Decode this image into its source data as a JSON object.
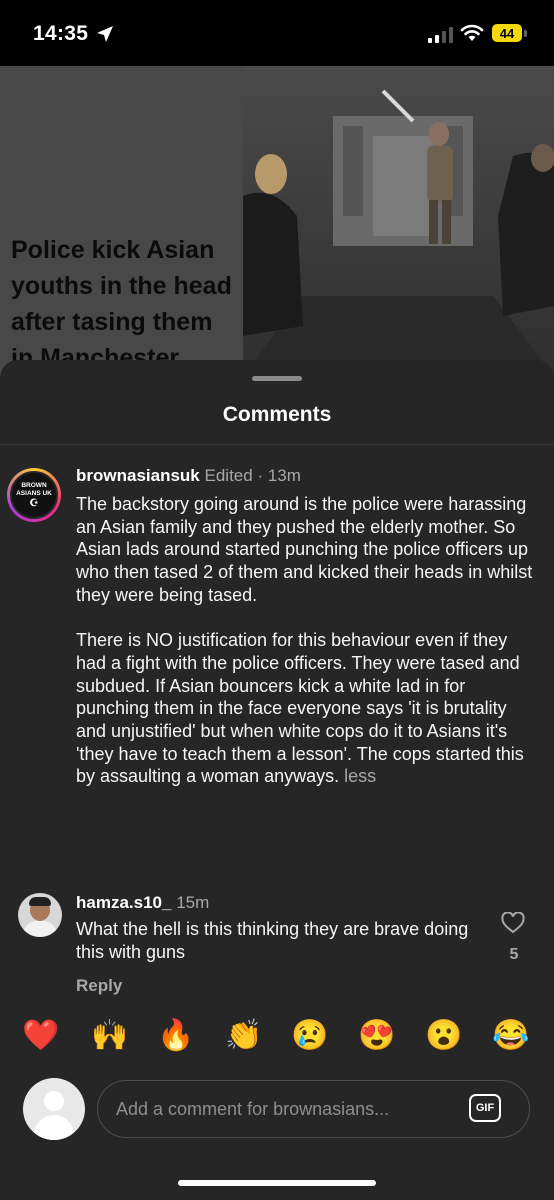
{
  "status_bar": {
    "time": "14:35",
    "battery": "44"
  },
  "post": {
    "headline": "Police kick Asian youths in the head after tasing them in Manchester"
  },
  "sheet": {
    "title": "Comments"
  },
  "comments": [
    {
      "username": "brownasiansuk",
      "edited": "Edited",
      "separator": "·",
      "time": "13m",
      "avatar_text": [
        "BROWN",
        "ASIANS UK"
      ],
      "paragraphs": [
        "The backstory going around is the police were harassing an Asian family and they pushed the elderly mother. So Asian lads around started punching the police officers up who then tased 2 of them and kicked their heads in whilst they were being tased.",
        "There is NO justification for this behaviour even if they had a fight with the police officers. They were tased and subdued. If Asian bouncers kick a white lad in for punching them in the face everyone says 'it is brutality and unjustified' but when white cops do it to Asians it's 'they have to teach them a lesson'. The cops started this by assaulting a woman anyways."
      ],
      "less": "less"
    },
    {
      "username": "hamza.s10_",
      "time": "15m",
      "text": "What the hell is this thinking they are brave doing this with guns",
      "likes": "5",
      "reply": "Reply"
    }
  ],
  "reactions": [
    "❤️",
    "🙌",
    "🔥",
    "👏",
    "😢",
    "😍",
    "😮",
    "😂"
  ],
  "composer": {
    "placeholder": "Add a comment for brownasians...",
    "gif": "GIF"
  },
  "colors": {
    "sheet_bg": "#262626",
    "secondary_text": "#a8a8a8",
    "battery": "#f5d90a"
  }
}
